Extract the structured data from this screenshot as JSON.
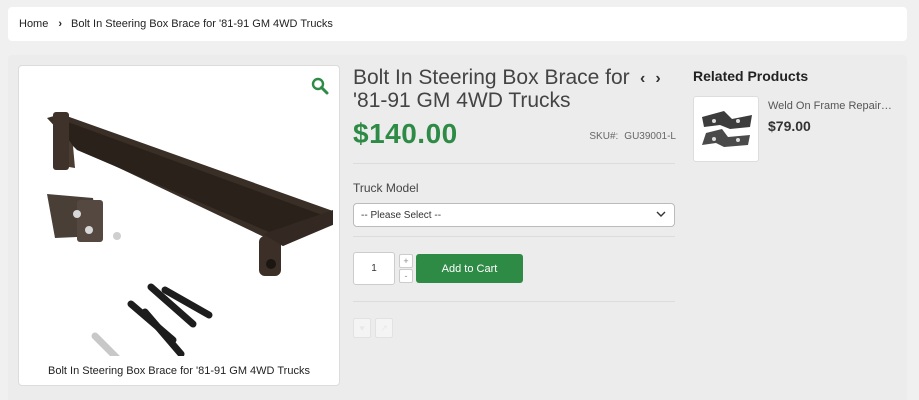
{
  "breadcrumb": {
    "home": "Home",
    "separator": "›",
    "current": "Bolt In Steering Box Brace for '81-91 GM 4WD Trucks"
  },
  "product": {
    "image_caption": "Bolt In Steering Box Brace for '81-91 GM 4WD Trucks",
    "title": "Bolt In Steering Box Brace for '81-91 GM 4WD Trucks",
    "prev_arrow": "‹",
    "next_arrow": "›",
    "price": "$140.00",
    "sku_label": "SKU#:",
    "sku_value": "GU39001-L"
  },
  "options": {
    "label": "Truck Model",
    "selected": "-- Please Select --"
  },
  "cart": {
    "quantity": "1",
    "increment": "+",
    "decrement": "-",
    "add_label": "Add to Cart"
  },
  "related": {
    "title": "Related Products",
    "items": [
      {
        "name": "Weld On Frame Repair Brackets",
        "price": "$79.00"
      }
    ]
  },
  "colors": {
    "accent": "#2e8b46",
    "background": "#f0f0f0"
  },
  "icons": [
    "chevron-right-icon",
    "zoom-icon",
    "chevron-left-icon",
    "chevron-down-icon",
    "heart-icon",
    "share-icon"
  ]
}
